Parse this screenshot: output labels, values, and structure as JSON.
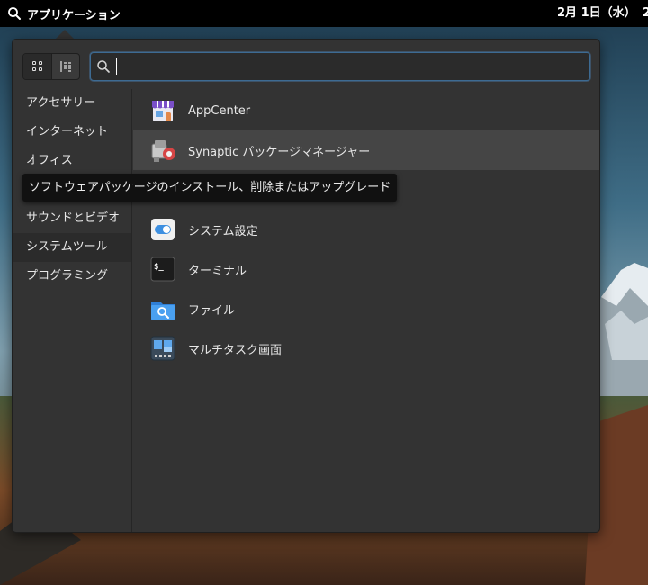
{
  "panel": {
    "launcher_label": "アプリケーション",
    "clock": "2月 1日（水）",
    "overflow_text": "2"
  },
  "search": {
    "value": "",
    "placeholder": ""
  },
  "view_modes": [
    "grid-view",
    "category-view"
  ],
  "categories": [
    {
      "label": "アクセサリー",
      "selected": false
    },
    {
      "label": "インターネット",
      "selected": false
    },
    {
      "label": "オフィス",
      "selected": false
    },
    {
      "label": "",
      "selected": false
    },
    {
      "label": "サウンドとビデオ",
      "selected": false
    },
    {
      "label": "システムツール",
      "selected": true
    },
    {
      "label": "プログラミング",
      "selected": false
    }
  ],
  "apps": [
    {
      "label": "AppCenter",
      "icon": "appcenter-icon"
    },
    {
      "label": "Synaptic パッケージマネージャー",
      "icon": "synaptic-icon",
      "hover": true
    },
    {
      "label": "",
      "icon": ""
    },
    {
      "label": "システム設定",
      "icon": "settings-toggle-icon"
    },
    {
      "label": "ターミナル",
      "icon": "terminal-icon"
    },
    {
      "label": "ファイル",
      "icon": "folder-search-icon"
    },
    {
      "label": "マルチタスク画面",
      "icon": "multitasking-icon"
    }
  ],
  "tooltip": {
    "text": "ソフトウェアパッケージのインストール、削除またはアップグレード"
  },
  "colors": {
    "panel": "#000000",
    "popover": "#333333",
    "selected_category": "#2b2b2b",
    "hover_row": "#454545",
    "search_focus": "#3d6b93"
  }
}
